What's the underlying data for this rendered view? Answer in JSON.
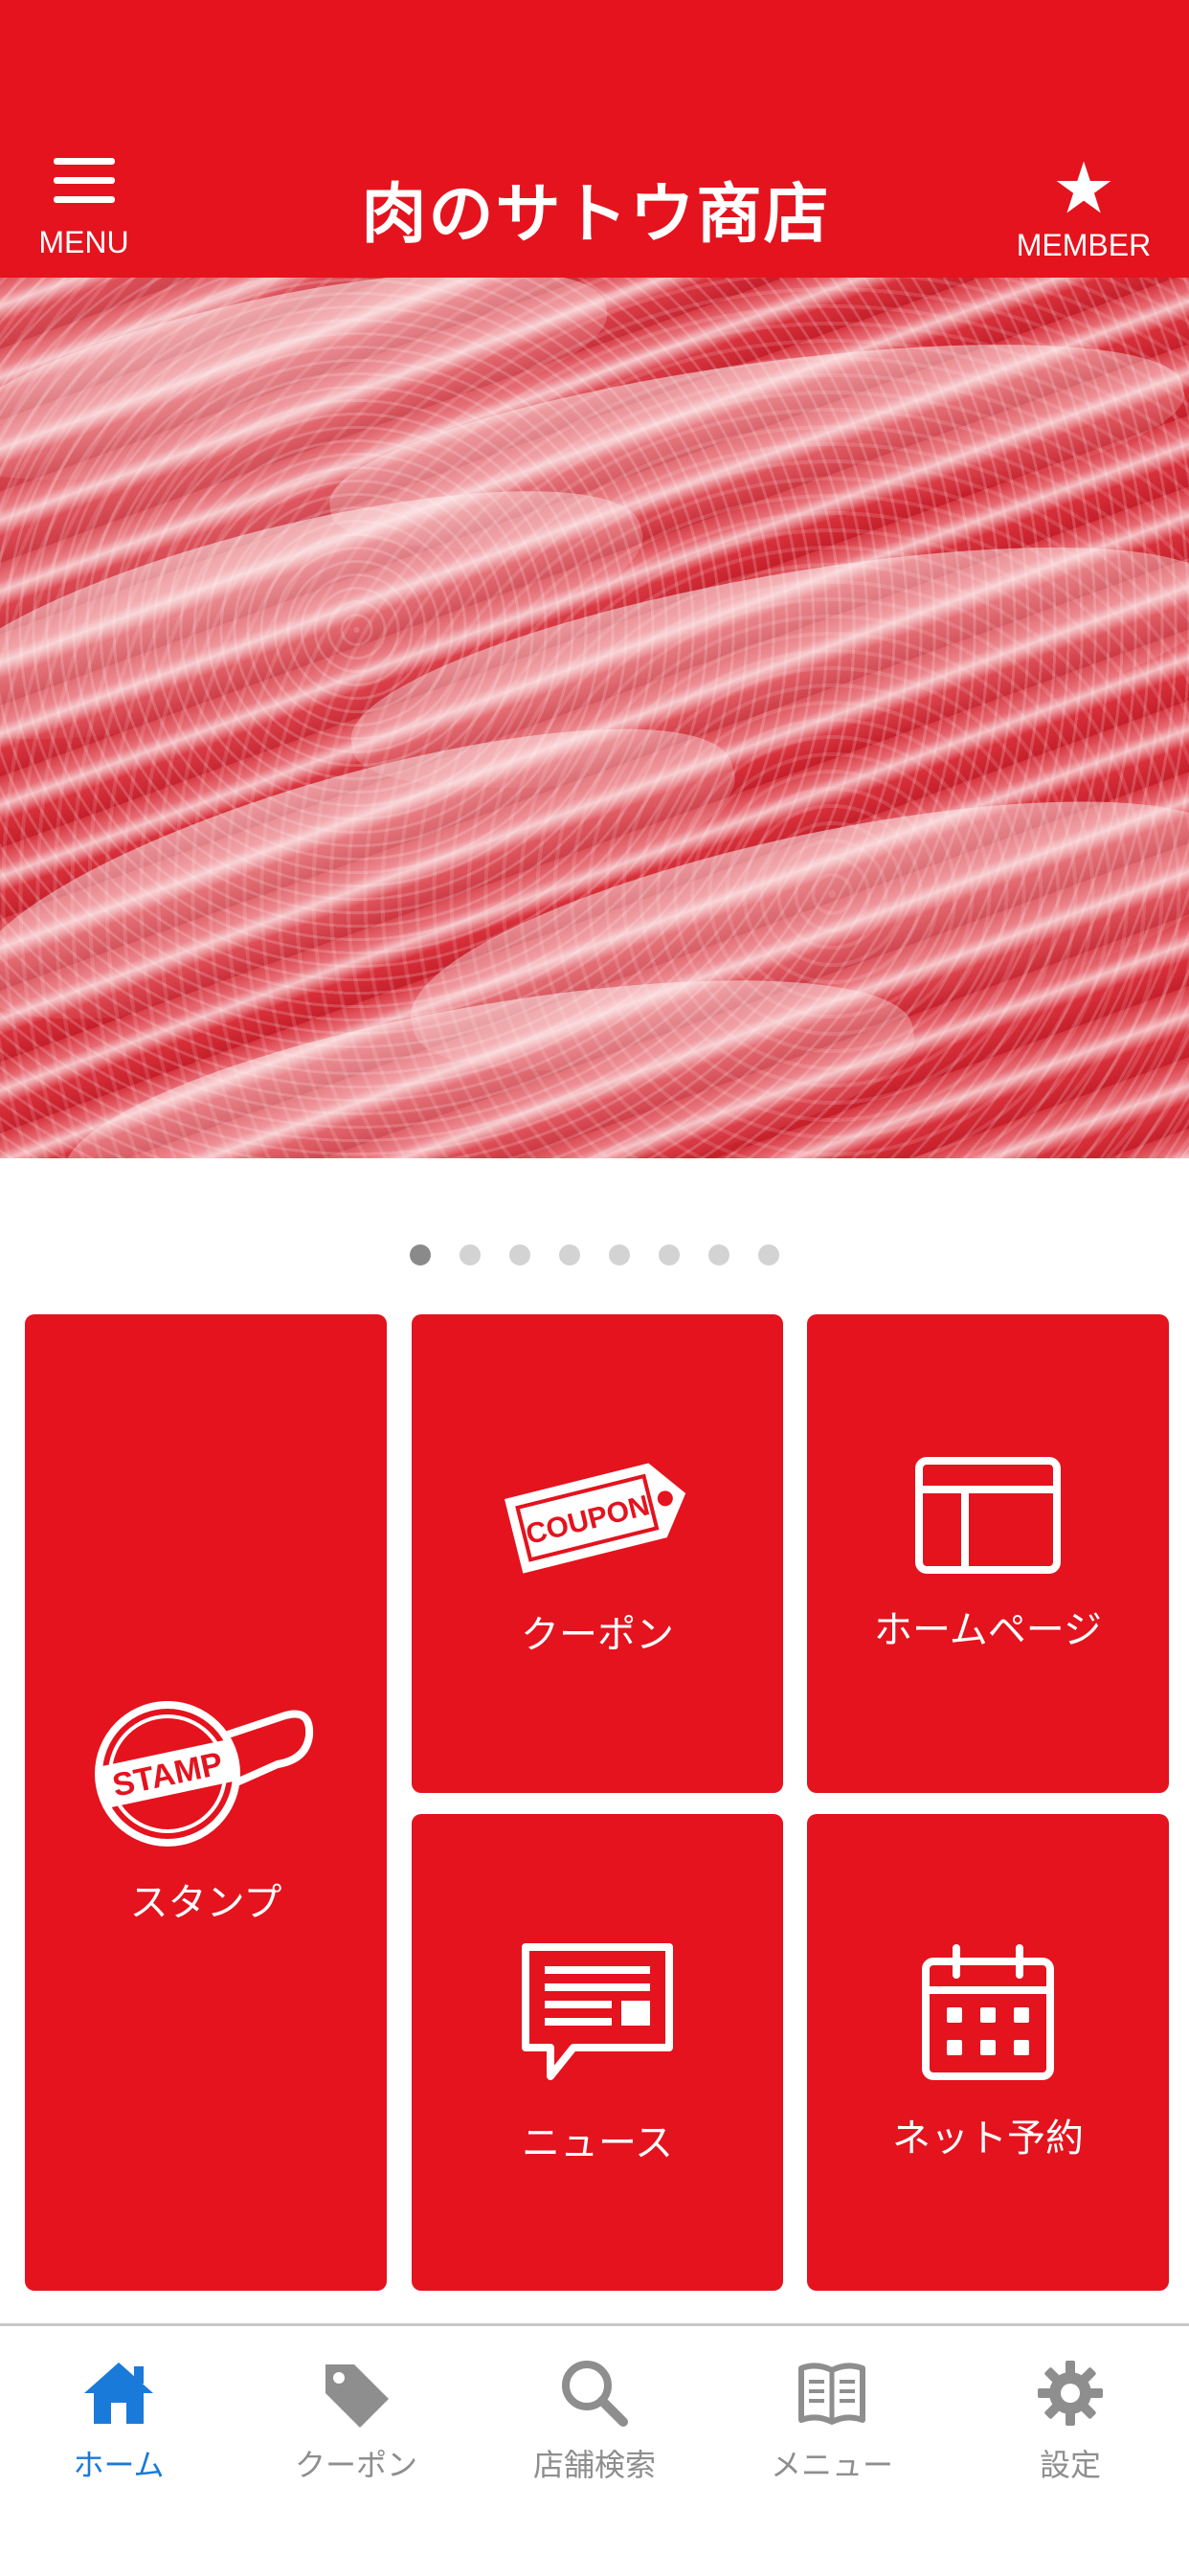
{
  "header": {
    "menu_label": "MENU",
    "member_label": "MEMBER",
    "logo_text": "肉のサトウ商店",
    "bg_color": "#e4131e"
  },
  "carousel": {
    "page_count": 8,
    "active_index": 0
  },
  "tiles": {
    "stamp": {
      "label": "スタンプ",
      "icon": "stamp-icon",
      "icon_text": "STAMP"
    },
    "coupon": {
      "label": "クーポン",
      "icon": "coupon-tag-icon",
      "icon_text": "COUPON"
    },
    "homepage": {
      "label": "ホームページ",
      "icon": "browser-window-icon"
    },
    "news": {
      "label": "ニュース",
      "icon": "news-speech-bubble-icon"
    },
    "reservation": {
      "label": "ネット予約",
      "icon": "calendar-icon"
    }
  },
  "tabbar": {
    "items": [
      {
        "label": "ホーム",
        "icon": "home-icon",
        "active": true
      },
      {
        "label": "クーポン",
        "icon": "tag-icon",
        "active": false
      },
      {
        "label": "店舗検索",
        "icon": "search-icon",
        "active": false
      },
      {
        "label": "メニュー",
        "icon": "book-icon",
        "active": false
      },
      {
        "label": "設定",
        "icon": "gear-icon",
        "active": false
      }
    ],
    "active_color": "#1a7ad9",
    "inactive_color": "#8e8e8e"
  }
}
